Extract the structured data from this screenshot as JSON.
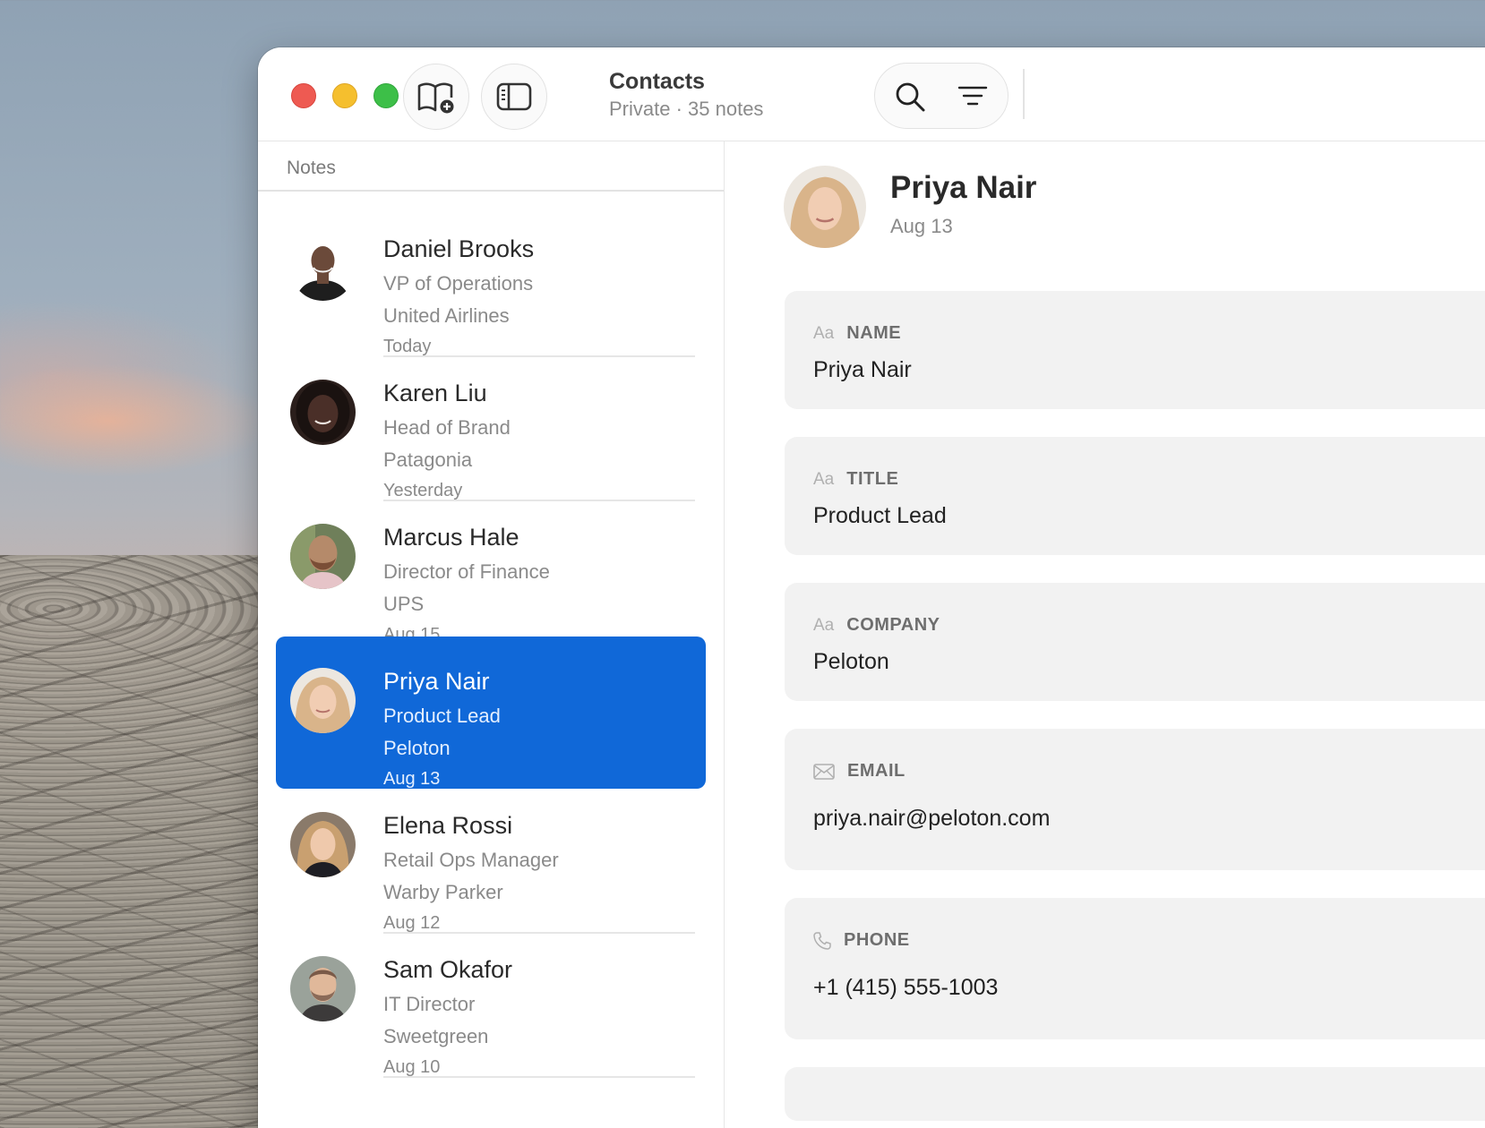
{
  "window": {
    "title": "Contacts",
    "subtitle": "Private · 35 notes"
  },
  "icons": {
    "new_notebook": "book-plus-icon",
    "toggle_sidebar": "sidebar-icon",
    "search": "search-icon",
    "filter": "filter-lines-icon"
  },
  "sidebar": {
    "header": "Notes",
    "items": [
      {
        "name": "Daniel Brooks",
        "title": "VP of Operations",
        "company": "United Airlines",
        "date": "Today",
        "avatar_color": "#6b4a3a"
      },
      {
        "name": "Karen Liu",
        "title": "Head of Brand",
        "company": "Patagonia",
        "date": "Yesterday",
        "avatar_color": "#4a2f28"
      },
      {
        "name": "Marcus Hale",
        "title": "Director of Finance",
        "company": "UPS",
        "date": "Aug 15",
        "avatar_color": "#b58a6a"
      },
      {
        "name": "Priya Nair",
        "title": "Product Lead",
        "company": "Peloton",
        "date": "Aug 13",
        "avatar_color": "#d9b48a",
        "selected": true
      },
      {
        "name": "Elena Rossi",
        "title": "Retail Ops Manager",
        "company": "Warby Parker",
        "date": "Aug 12",
        "avatar_color": "#c9a070"
      },
      {
        "name": "Sam Okafor",
        "title": "IT Director",
        "company": "Sweetgreen",
        "date": "Aug 10",
        "avatar_color": "#7a5a48"
      }
    ]
  },
  "detail": {
    "name": "Priya Nair",
    "date": "Aug 13",
    "fields": [
      {
        "icon": "Aa",
        "label": "NAME",
        "value": "Priya Nair"
      },
      {
        "icon": "Aa",
        "label": "TITLE",
        "value": "Product Lead"
      },
      {
        "icon": "Aa",
        "label": "COMPANY",
        "value": "Peloton"
      },
      {
        "icon": "envelope-icon",
        "label": "EMAIL",
        "value": "priya.nair@peloton.com"
      },
      {
        "icon": "phone-icon",
        "label": "PHONE",
        "value": "+1 (415) 555-1003"
      }
    ]
  },
  "colors": {
    "accent": "#1068d8",
    "close": "#ee5a52",
    "minimize": "#f5bf2e",
    "zoom": "#3dbf48"
  }
}
